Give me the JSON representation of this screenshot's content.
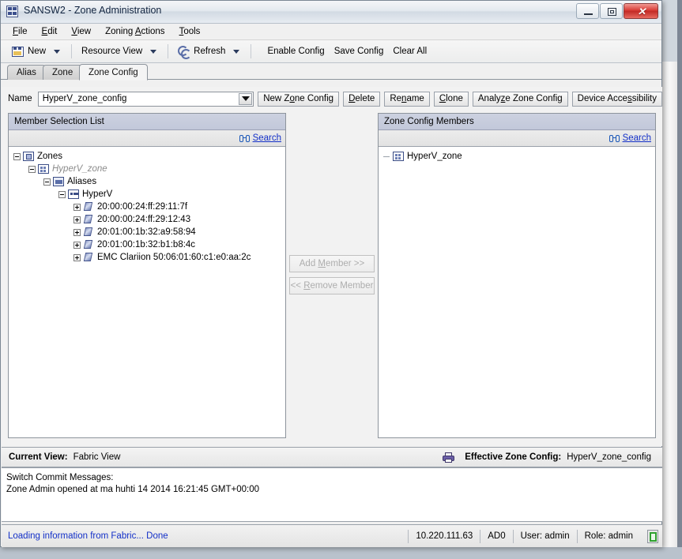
{
  "window": {
    "title": "SANSW2 - Zone Administration",
    "icon": "app-grid-icon",
    "minimize": "minimize-icon",
    "maximize": "maximize-icon",
    "close": "✕"
  },
  "menubar": [
    {
      "label": "File",
      "mnemonic": "F"
    },
    {
      "label": "Edit",
      "mnemonic": "E"
    },
    {
      "label": "View",
      "mnemonic": "V"
    },
    {
      "label": "Zoning Actions",
      "mnemonic": "A"
    },
    {
      "label": "Tools",
      "mnemonic": "T"
    }
  ],
  "toolbar": {
    "new_label": "New",
    "resource_view_label": "Resource View",
    "refresh_label": "Refresh",
    "enable_config_label": "Enable Config",
    "save_config_label": "Save Config",
    "clear_all_label": "Clear All"
  },
  "tabs": [
    {
      "label": "Alias",
      "active": false
    },
    {
      "label": "Zone",
      "active": false
    },
    {
      "label": "Zone Config",
      "active": true
    }
  ],
  "name_row": {
    "label": "Name",
    "value": "HyperV_zone_config",
    "buttons": [
      {
        "label": "New Zone Config",
        "pre": "New Z",
        "mnemonic": "o",
        "post": "ne Config"
      },
      {
        "label": "Delete",
        "pre": "",
        "mnemonic": "D",
        "post": "elete"
      },
      {
        "label": "Rename",
        "pre": "Re",
        "mnemonic": "n",
        "post": "ame"
      },
      {
        "label": "Clone",
        "pre": "",
        "mnemonic": "C",
        "post": "lone"
      },
      {
        "label": "Analyze Zone Config",
        "pre": "Analy",
        "mnemonic": "z",
        "post": "e Zone Config"
      },
      {
        "label": "Device Accessibility",
        "pre": "Device Acce",
        "mnemonic": "s",
        "post": "sibility"
      }
    ]
  },
  "left_panel": {
    "header": "Member Selection List",
    "search_label": "Search",
    "search_icon": "binoculars-icon",
    "tree": [
      {
        "label": "Zones",
        "depth": 0,
        "toggle": "minus",
        "icon": "zones-folder-icon",
        "italic": false
      },
      {
        "label": "HyperV_zone",
        "depth": 1,
        "toggle": "minus",
        "icon": "zone-icon",
        "italic": true
      },
      {
        "label": "Aliases",
        "depth": 2,
        "toggle": "minus",
        "icon": "aliases-icon",
        "italic": false
      },
      {
        "label": "HyperV",
        "depth": 3,
        "toggle": "minus",
        "icon": "alias-icon",
        "italic": false
      },
      {
        "label": "20:00:00:24:ff:29:11:7f",
        "depth": 4,
        "toggle": "plus",
        "icon": "wwn-icon",
        "italic": false
      },
      {
        "label": "20:00:00:24:ff:29:12:43",
        "depth": 4,
        "toggle": "plus",
        "icon": "wwn-icon",
        "italic": false
      },
      {
        "label": "20:01:00:1b:32:a9:58:94",
        "depth": 4,
        "toggle": "plus",
        "icon": "wwn-icon",
        "italic": false
      },
      {
        "label": "20:01:00:1b:32:b1:b8:4c",
        "depth": 4,
        "toggle": "plus",
        "icon": "wwn-icon",
        "italic": false
      },
      {
        "label": "EMC Clariion 50:06:01:60:c1:e0:aa:2c",
        "depth": 4,
        "toggle": "plus",
        "icon": "wwn-icon",
        "italic": false
      }
    ]
  },
  "right_panel": {
    "header": "Zone Config Members",
    "search_label": "Search",
    "search_icon": "binoculars-icon",
    "tree": [
      {
        "label": "HyperV_zone",
        "depth": 0,
        "toggle": "dash",
        "icon": "zone-icon",
        "italic": false
      }
    ]
  },
  "transfer_buttons": {
    "add": {
      "pre": "Add ",
      "mnemonic": "M",
      "post": "ember >>",
      "enabled": false
    },
    "remove": {
      "pre": "<< ",
      "mnemonic": "R",
      "post": "emove Member",
      "enabled": false
    }
  },
  "view_bar": {
    "current_view_label": "Current View:",
    "current_view_value": "Fabric View",
    "printer_icon": "printer-icon",
    "effective_label": "Effective Zone Config:",
    "effective_value": "HyperV_zone_config"
  },
  "messages": {
    "title": "Switch Commit Messages:",
    "lines": [
      "Zone Admin opened at ma huhti 14 2014 16:21:45 GMT+00:00"
    ]
  },
  "status_bar": {
    "message": "Loading information from Fabric... Done",
    "ip": "10.220.111.63",
    "ad": "AD0",
    "user": "User: admin",
    "role": "Role: admin",
    "indicator_icon": "switch-status-icon"
  },
  "colors": {
    "link": "#1330c8",
    "panel_header": "#c6cbdb",
    "close_button": "#d83b35",
    "tree_icon_blue": "#3b4d86"
  }
}
